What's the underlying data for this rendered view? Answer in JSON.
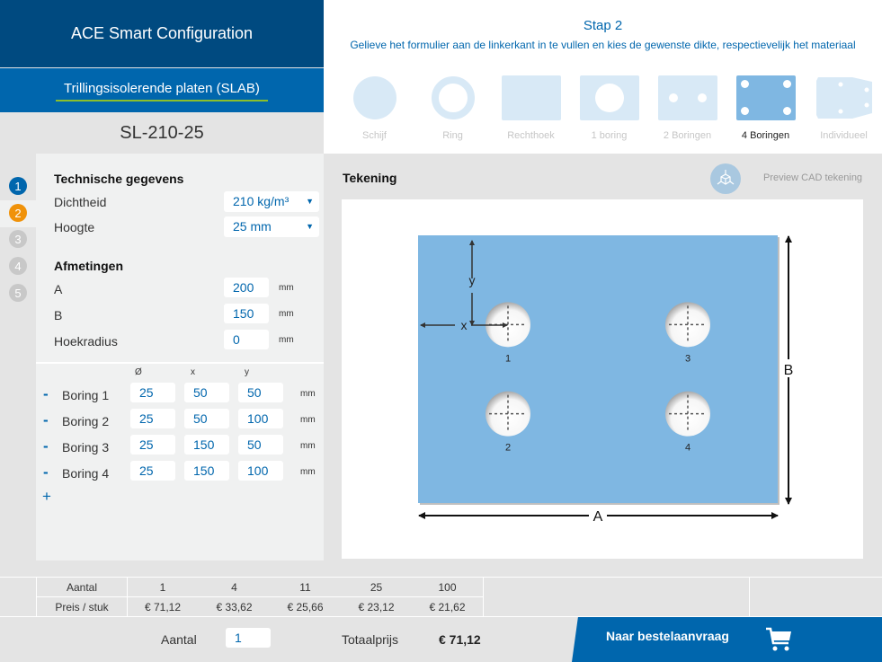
{
  "header": {
    "app_title": "ACE Smart Configuration",
    "product_name": "Trillingsisolerende platen (SLAB)",
    "product_code": "SL-210-25"
  },
  "step": {
    "title": "Stap 2",
    "description": "Gelieve het formulier aan de linkerkant in te vullen en kies de gewenste dikte, respectievelijk het materiaal"
  },
  "shapes": [
    {
      "label": "Schijf",
      "icon": "disc-icon",
      "active": false
    },
    {
      "label": "Ring",
      "icon": "ring-icon",
      "active": false
    },
    {
      "label": "Rechthoek",
      "icon": "rectangle-icon",
      "active": false
    },
    {
      "label": "1 boring",
      "icon": "one-hole-icon",
      "active": false
    },
    {
      "label": "2 Boringen",
      "icon": "two-holes-icon",
      "active": false
    },
    {
      "label": "4 Boringen",
      "icon": "four-holes-icon",
      "active": true
    },
    {
      "label": "Individueel",
      "icon": "custom-shape-icon",
      "active": false
    }
  ],
  "steps_nav": [
    {
      "num": "1",
      "color": "#0066ad"
    },
    {
      "num": "2",
      "color": "#f0920a"
    },
    {
      "num": "3",
      "color": "#c8c8c8"
    },
    {
      "num": "4",
      "color": "#c8c8c8"
    },
    {
      "num": "5",
      "color": "#c8c8c8"
    }
  ],
  "form": {
    "tech_title": "Technische gegevens",
    "density_label": "Dichtheid",
    "density_value": "210 kg/m³",
    "height_label": "Hoogte",
    "height_value": "25 mm",
    "dims_title": "Afmetingen",
    "a_label": "A",
    "a_value": "200",
    "b_label": "B",
    "b_value": "150",
    "radius_label": "Hoekradius",
    "radius_value": "0",
    "unit": "mm",
    "col_diameter": "Ø",
    "col_x": "x",
    "col_y": "y",
    "minus": "-",
    "plus": "+",
    "holes": [
      {
        "label": "Boring 1",
        "d": "25",
        "x": "50",
        "y": "50"
      },
      {
        "label": "Boring 2",
        "d": "25",
        "x": "50",
        "y": "100"
      },
      {
        "label": "Boring 3",
        "d": "25",
        "x": "150",
        "y": "50"
      },
      {
        "label": "Boring 4",
        "d": "25",
        "x": "150",
        "y": "100"
      }
    ]
  },
  "drawing": {
    "title": "Tekening",
    "cad_label": "Preview CAD tekening",
    "dim_a": "A",
    "dim_b": "B",
    "dim_x": "x",
    "dim_y": "y",
    "hole_labels": [
      "1",
      "2",
      "3",
      "4"
    ],
    "plate_color": "#7fb7e2"
  },
  "price_table": {
    "qty_header": "Aantal",
    "price_header": "Preis / stuk",
    "quantities": [
      "1",
      "4",
      "11",
      "25",
      "100"
    ],
    "prices": [
      "€ 71,12",
      "€ 33,62",
      "€ 25,66",
      "€ 23,12",
      "€ 21,62"
    ]
  },
  "footer": {
    "qty_label": "Aantal",
    "qty_value": "1",
    "total_label": "Totaalprijs",
    "total_value": "€ 71,12",
    "order_button": "Naar bestelaanvraag"
  }
}
